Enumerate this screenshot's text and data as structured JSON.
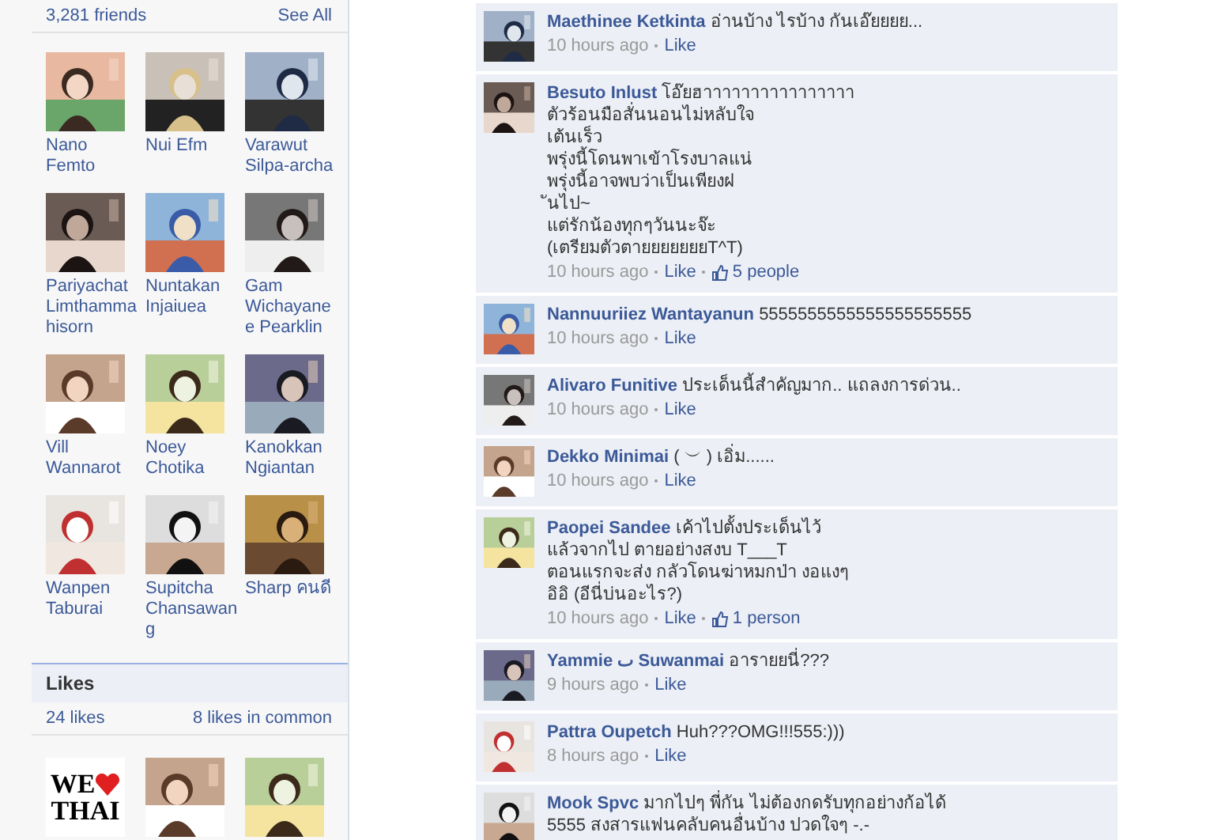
{
  "friends": {
    "count": "3,281 friends",
    "see_all": "See All",
    "items": [
      {
        "name": "Nano Femto"
      },
      {
        "name": "Nui Efm"
      },
      {
        "name": "Varawut Silpa-archa"
      },
      {
        "name": "Pariyachat Limthammahisorn"
      },
      {
        "name": "Nuntakan Injaiuea"
      },
      {
        "name": "Gam Wichayanee Pearklin"
      },
      {
        "name": "Vill Wannarot"
      },
      {
        "name": "Noey Chotika"
      },
      {
        "name": "Kanokkan Ngiantan"
      },
      {
        "name": "Wanpen Taburai"
      },
      {
        "name": "Supitcha Chansawang"
      },
      {
        "name": "Sharp คนดี"
      }
    ]
  },
  "likes": {
    "title": "Likes",
    "count": "24 likes",
    "common": "8 likes in common",
    "items": [
      {
        "kind": "logo",
        "line1": "WE",
        "line2": "THAI"
      },
      {
        "kind": "picture"
      },
      {
        "kind": "picture"
      }
    ]
  },
  "comments": [
    {
      "author": "Maethinee Ketkinta",
      "text": "อ่านบ้าง ไรบ้าง กันเอ๊ยยยย...",
      "time": "10 hours ago",
      "like": "Like"
    },
    {
      "author": "Besuto Inlust",
      "text": "โอ๊ยฮาาาาาาาาาาาาาาาา\nตัวร้อนมือสั่นนอนไม่หลับใจ\nเต้นเร็ว\nพรุ่งนี้โดนพาเข้าโรงบาลแน่\nพรุ่งนี้อาจพบว่าเป็นเพียงฝ\nันไป~\nแต่รักน้องทุกๆวันนะจ๊ะ\n(เตรียมตัวตายยยยยยยT^T)",
      "time": "10 hours ago",
      "like": "Like",
      "likes": "5 people"
    },
    {
      "author": "Nannuuriiez Wantayanun",
      "text": "5555555555555555555555",
      "time": "10 hours ago",
      "like": "Like"
    },
    {
      "author": "Alivaro Funitive",
      "text": "ประเด็นนี้สำคัญมาก.. แถลงการด่วน..",
      "time": "10 hours ago",
      "like": "Like"
    },
    {
      "author": "Dekko Minimai",
      "text": "(   ︶   ) เอิ่ม......",
      "time": "10 hours ago",
      "like": "Like"
    },
    {
      "author": "Paopei Sandee",
      "text": "เค้าไปตั้งประเด็นไว้\nแล้วจากไป ตายอย่างสงบ T___T\nตอนแรกจะส่ง กลัวโดนฆ่าหมกป่า งอแงๆ\nอิอิ (อีนี่บ่นอะไร?)",
      "time": "10 hours ago",
      "like": "Like",
      "likes": "1 person"
    },
    {
      "author": "Yammie ٮ Suwanmai",
      "text": "อารายยนี่???",
      "time": "9 hours ago",
      "like": "Like"
    },
    {
      "author": "Pattra Oupetch",
      "text": "Huh???OMG!!!555:)))",
      "time": "8 hours ago",
      "like": "Like"
    },
    {
      "author": "Mook Spvc",
      "text": "มากไปๆ พี่กัน ไม่ต้องกดรับทุกอย่างก้อได้\n5555 สงสารแฟนคลับคนอื่นบ้าง ปวดใจๆ -.-"
    }
  ]
}
